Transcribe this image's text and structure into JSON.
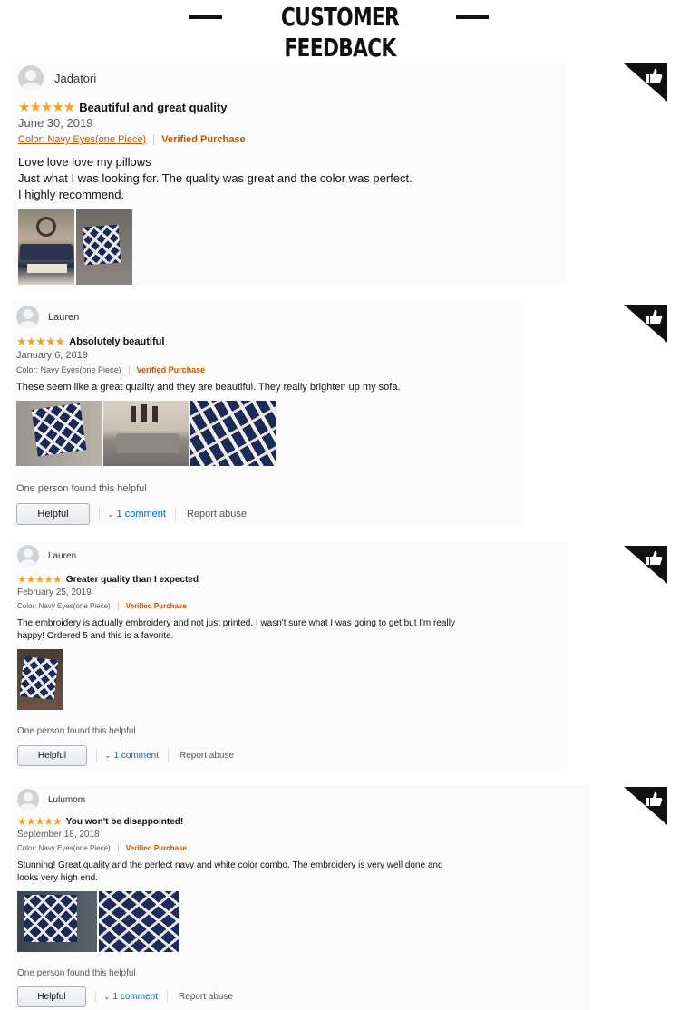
{
  "header": {
    "title": "CUSTOMER FEEDBACK"
  },
  "reviews": [
    {
      "author": "Jadatori",
      "stars": "★★★★★",
      "title": "Beautiful and great quality",
      "date": "June 30, 2019",
      "variant": "Color: Navy Eyes(one Piece)",
      "verified": "Verified Purchase",
      "body": [
        "Love love love my pillows",
        "Just what I was looking for. The quality was great and the color was perfect.",
        "I highly recommend."
      ],
      "helpful_count": "",
      "helpful_label": "",
      "comment_label": "",
      "report_label": ""
    },
    {
      "author": "Lauren",
      "stars": "★★★★★",
      "title": "Absolutely beautiful",
      "date": "January 6, 2019",
      "variant": "Color: Navy Eyes(one Piece)",
      "verified": "Verified Purchase",
      "body": [
        "These seem like a great quality and they are beautiful. They really brighten up my sofa."
      ],
      "helpful_count": "One person found this helpful",
      "helpful_label": "Helpful",
      "comment_label": "1 comment",
      "report_label": "Report abuse"
    },
    {
      "author": "Lauren",
      "stars": "★★★★★",
      "title": "Greater quality than I expected",
      "date": "February 25, 2019",
      "variant": "Color: Navy Eyes(one Piece)",
      "verified": "Verified Purchase",
      "body": [
        "The embroidery is actually embroidery and not just printed. I wasn't sure what I was going to get but I'm really",
        "happy! Ordered 5 and this is a favorite."
      ],
      "helpful_count": "One person found this helpful",
      "helpful_label": "Helpful",
      "comment_label": "1 comment",
      "report_label": "Report abuse"
    },
    {
      "author": "Lulumom",
      "stars": "★★★★★",
      "title": "You won't be disappointed!",
      "date": "September 18, 2018",
      "variant": "Color: Navy Eyes(one Piece)",
      "verified": "Verified Purchase",
      "body": [
        "Stunning! Great quality and the perfect navy and white color combo. The embroidery is very well done and",
        "looks very high end."
      ],
      "helpful_count": "One person found this helpful",
      "helpful_label": "Helpful",
      "comment_label": "1 comment",
      "report_label": "Report abuse"
    }
  ],
  "icons": {
    "thumbs_up_badge": "thumbs-up-icon",
    "avatar": "default-user-icon",
    "comment_toggle": "chevron-down-icon"
  },
  "colors": {
    "star": "#f0a41b",
    "verified": "#c45500",
    "link": "#0066c0",
    "badge": "#111111"
  }
}
